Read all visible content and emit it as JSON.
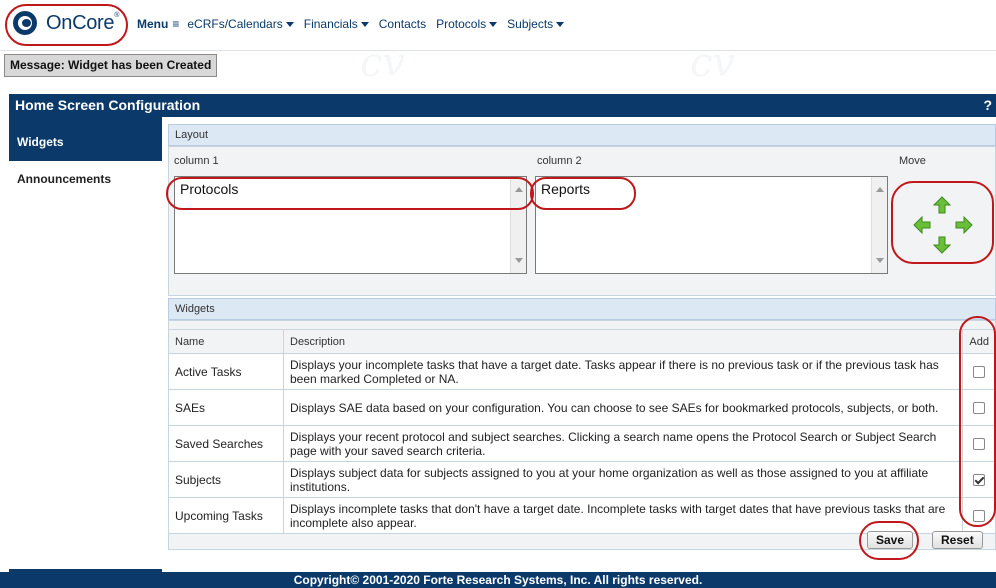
{
  "header": {
    "logo_text": "OnCore",
    "logo_mark": "®",
    "nav": {
      "menu_label": "Menu",
      "menu_icon": "≡",
      "items": [
        "eCRFs/Calendars",
        "Financials",
        "Contacts",
        "Protocols",
        "Subjects"
      ]
    }
  },
  "message": "Message: Widget has been Created",
  "panel": {
    "title": "Home Screen Configuration",
    "help": "?"
  },
  "sidebar": {
    "items": [
      {
        "label": "Widgets",
        "active": true
      },
      {
        "label": "Announcements",
        "active": false
      }
    ]
  },
  "layout": {
    "section_label": "Layout",
    "column1_label": "column 1",
    "column2_label": "column 2",
    "move_label": "Move",
    "column1_items": [
      "Protocols"
    ],
    "column2_items": [
      "Reports"
    ]
  },
  "widgets": {
    "section_label": "Widgets",
    "headers": {
      "name": "Name",
      "description": "Description",
      "add": "Add"
    },
    "rows": [
      {
        "name": "Active Tasks",
        "description": "Displays your incomplete tasks that have a target date. Tasks appear if there is no previous task or if the previous task has been marked Completed or NA.",
        "checked": false
      },
      {
        "name": "SAEs",
        "description": "Displays SAE data based on your configuration. You can choose to see SAEs for bookmarked protocols, subjects, or both.",
        "checked": false
      },
      {
        "name": "Saved Searches",
        "description": "Displays your recent protocol and subject searches. Clicking a search name opens the Protocol Search or Subject Search page with your saved search criteria.",
        "checked": false
      },
      {
        "name": "Subjects",
        "description": "Displays subject data for subjects assigned to you at your home organization as well as those assigned to you at affiliate institutions.",
        "checked": true
      },
      {
        "name": "Upcoming Tasks",
        "description": "Displays incomplete tasks that don't have a target date. Incomplete tasks with target dates that have previous tasks that are incomplete also appear.",
        "checked": false
      }
    ]
  },
  "buttons": {
    "save": "Save",
    "reset": "Reset"
  },
  "footer": "Copyright© 2001-2020 Forte Research Systems, Inc. All rights reserved.",
  "colors": {
    "brand_navy": "#0b3a6a",
    "annotation_red": "#c0171b",
    "arrow_green": "#6abf3a"
  }
}
